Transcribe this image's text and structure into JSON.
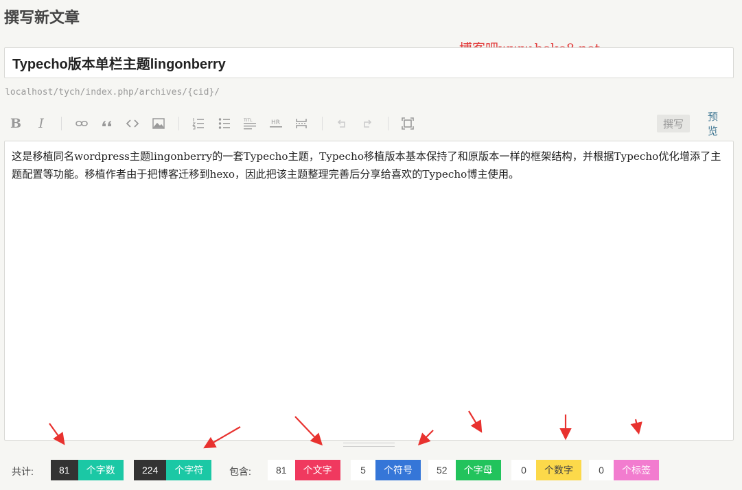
{
  "page": {
    "title": "撰写新文章"
  },
  "watermark": "博客吧www.boke8.net",
  "post": {
    "title": "Typecho版本单栏主题lingonberry",
    "permalink": "localhost/tych/index.php/archives/{cid}/",
    "content": "这是移植同名wordpress主题lingonberry的一套Typecho主题，Typecho移植版本基本保持了和原版本一样的框架结构，并根据Typecho优化增添了主题配置等功能。移植作者由于把博客迁移到hexo，因此把该主题整理完善后分享给喜欢的Typecho博主使用。"
  },
  "toolbar": {
    "icons": [
      "bold-icon",
      "italic-icon",
      "link-icon",
      "quote-icon",
      "code-icon",
      "image-icon",
      "ordered-list-icon",
      "unordered-list-icon",
      "heading-icon",
      "hr-icon",
      "more-icon",
      "undo-icon",
      "redo-icon",
      "fullscreen-icon"
    ],
    "bold": "B",
    "italic": "I",
    "tab_write": "撰写",
    "tab_preview": "预览"
  },
  "stats": {
    "total_label": "共计:",
    "contains_label": "包含:",
    "words": {
      "value": "81",
      "label": "个字数",
      "color": "#1bc8a5"
    },
    "chars": {
      "value": "224",
      "label": "个字符",
      "color": "#1bc8a5"
    },
    "cjk": {
      "value": "81",
      "label": "个文字",
      "color": "#f0395f"
    },
    "symbols": {
      "value": "5",
      "label": "个符号",
      "color": "#3576d8"
    },
    "letters": {
      "value": "52",
      "label": "个字母",
      "color": "#22c35c"
    },
    "digits": {
      "value": "0",
      "label": "个数字",
      "color": "#fcd94a"
    },
    "tags": {
      "value": "0",
      "label": "个标签",
      "color": "#f27ccf"
    }
  },
  "colors": {
    "arrow": "#e8322f",
    "link": "#467b96",
    "background": "#f6f6f3"
  }
}
